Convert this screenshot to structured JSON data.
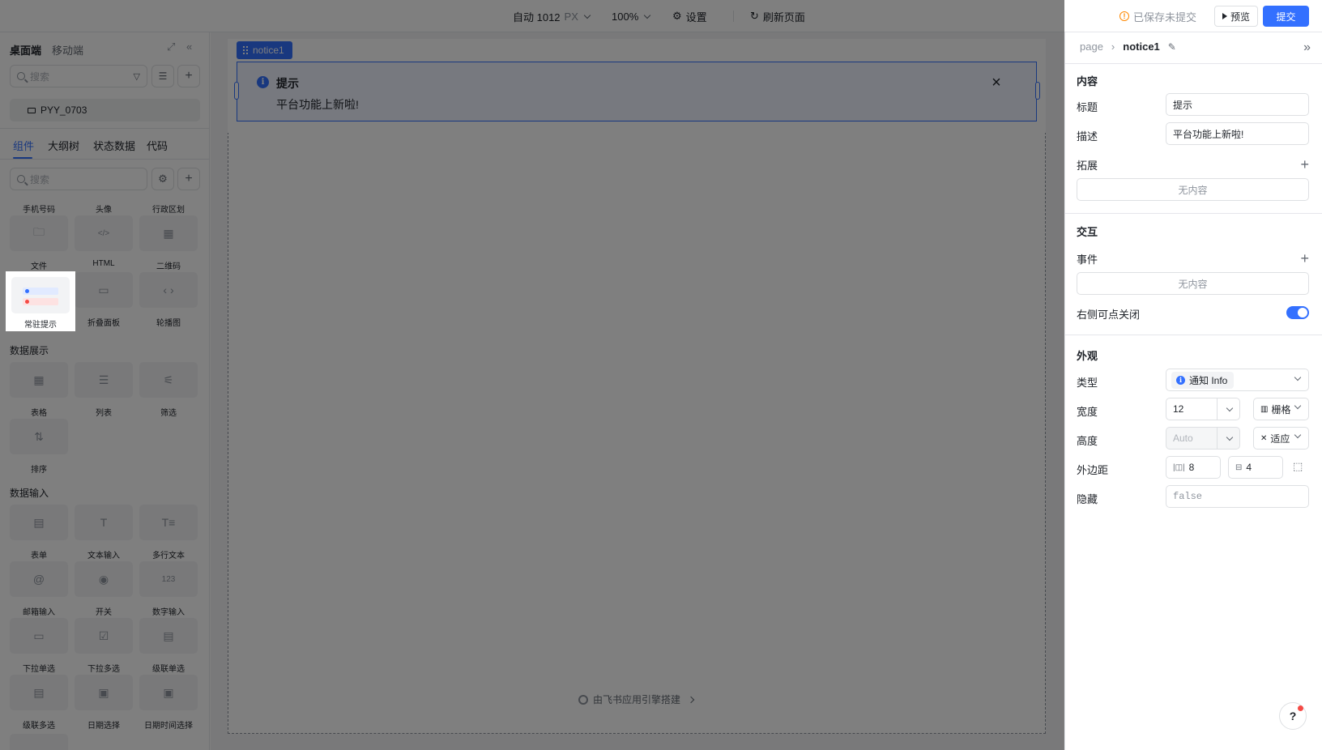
{
  "topbar": {
    "size_label": "自动 1012",
    "size_unit": "PX",
    "zoom": "100%",
    "settings": "设置",
    "refresh": "刷新页面",
    "save_status": "已保存未提交",
    "preview": "预览",
    "submit": "提交"
  },
  "left": {
    "mode_desktop": "桌面端",
    "mode_mobile": "移动端",
    "search_placeholder": "搜索",
    "app_name": "PYY_0703",
    "tabs": [
      "组件",
      "大纲树",
      "状态数据",
      "代码"
    ],
    "comp_search_placeholder": "搜索",
    "partial_labels": [
      "手机号码",
      "头像",
      "行政区划"
    ],
    "row1": [
      "文件",
      "HTML",
      "二维码"
    ],
    "row2": [
      "常驻提示",
      "折叠面板",
      "轮播图"
    ],
    "section_display": "数据展示",
    "display": [
      "表格",
      "列表",
      "筛选",
      "排序"
    ],
    "section_input": "数据输入",
    "input_row1": [
      "表单",
      "文本输入",
      "多行文本"
    ],
    "input_row2": [
      "邮箱输入",
      "开关",
      "数字输入"
    ],
    "input_row3": [
      "下拉单选",
      "下拉多选",
      "级联单选"
    ],
    "input_row4": [
      "级联多选",
      "日期选择",
      "日期时间选择"
    ]
  },
  "canvas": {
    "selected_tag": "notice1",
    "notice_title": "提示",
    "notice_desc": "平台功能上新啦!",
    "footer": "由飞书应用引擎搭建"
  },
  "right": {
    "crumb_parent": "page",
    "crumb_current": "notice1",
    "section_content": "内容",
    "label_title": "标题",
    "value_title": "提示",
    "label_desc": "描述",
    "value_desc": "平台功能上新啦!",
    "label_extend": "拓展",
    "empty_1": "无内容",
    "section_interact": "交互",
    "label_event": "事件",
    "empty_2": "无内容",
    "label_closable": "右侧可点关闭",
    "closable_on": true,
    "section_appearance": "外观",
    "label_type": "类型",
    "value_type": "通知 Info",
    "label_width": "宽度",
    "value_width": "12",
    "width_mode": "栅格",
    "label_height": "高度",
    "value_height": "Auto",
    "height_mode": "适应",
    "label_margin": "外边距",
    "margin_h": "8",
    "margin_v": "4",
    "label_hidden": "隐藏",
    "value_hidden": "false"
  },
  "colors": {
    "primary": "#3370ff",
    "notice_bg": "#eef3ff",
    "warning": "#ff8800"
  }
}
